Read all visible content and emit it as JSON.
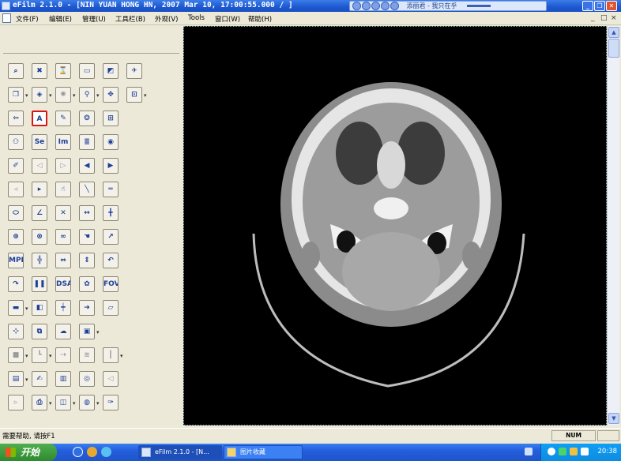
{
  "window": {
    "title": "eFilm 2.1.0 - [NIN YUAN HONG HN, 2007 Mar 10, 17:00:55.000  /  ]",
    "media_player_text": "添丽君 - 我只在乎"
  },
  "menu": {
    "items": [
      "文件(F)",
      "编辑(E)",
      "管理(U)",
      "工具栏(B)",
      "外观(V)",
      "Tools",
      "窗口(W)",
      "帮助(H)"
    ],
    "mdi_controls": [
      "_",
      "□",
      "×"
    ]
  },
  "toolbar": {
    "rows": [
      [
        "search-zoom",
        "delete",
        "hourglass",
        "open-folder",
        "layout",
        "export"
      ],
      [
        "copy",
        "window-level",
        "brightness",
        "magnifier",
        "pan",
        "zoom-box"
      ],
      [
        "back-arrow",
        "annotate-text",
        "edit-pen",
        "film",
        "grid"
      ],
      [
        "patients",
        "series",
        "images",
        "report",
        "eye"
      ],
      [
        "measure-pen",
        "prev-series",
        "next-series",
        "series-back",
        "series-forward"
      ],
      [
        "image-back",
        "image-forward",
        "hand-tool",
        "line-tool",
        "ruler"
      ],
      [
        "ellipse-roi",
        "angle-tool",
        "cross-tool",
        "distance-tool",
        "cursor-cross"
      ],
      [
        "fit-1",
        "fit-2",
        "link",
        "hand-link",
        "arrow"
      ],
      [
        "mpr",
        "mpr-cross",
        "swap-h",
        "swap-v",
        "rotate-left"
      ],
      [
        "rotate-right",
        "pause",
        "dsa",
        "cine",
        "fov"
      ],
      [
        "colorbar",
        "contrast-step",
        "timeline",
        "color-arrow",
        "open-file"
      ],
      [
        "mip-pan",
        "key-image",
        "eye-cloud",
        "3d-view"
      ],
      [
        "dim-square",
        "dim-ruler",
        "dim-arrow",
        "mpr-dim",
        "dim-scale"
      ],
      [
        "scanner",
        "edit-card",
        "save-card",
        "camera",
        "lock"
      ],
      [
        "dim-next",
        "print",
        "hanging",
        "cd-burn",
        "tools"
      ]
    ],
    "labels": {
      "annotate_text": "A",
      "series_label": "Se",
      "images_label": "Im",
      "dsa_label": "DSA",
      "fov_label": "FOV",
      "mpr_label": "MPR"
    }
  },
  "status": {
    "help_text": "需要帮助, 请按F1",
    "num_indicator": "NUM"
  },
  "taskbar": {
    "start_label": "开始",
    "tasks": [
      {
        "label": "eFilm 2.1.0 - [N...",
        "active": true
      },
      {
        "label": "图片收藏",
        "active": false
      }
    ],
    "clock": "20:38"
  }
}
